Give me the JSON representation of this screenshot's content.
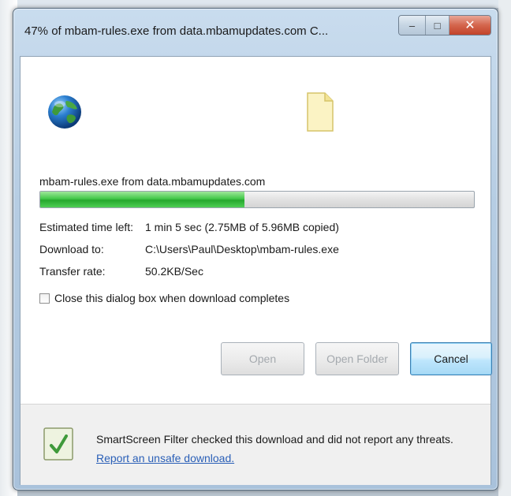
{
  "window": {
    "title": "47% of mbam-rules.exe from data.mbamupdates.com C...",
    "minimize_glyph": "–",
    "maximize_glyph": "□",
    "close_glyph": "✕"
  },
  "download": {
    "file_line": "mbam-rules.exe from data.mbamupdates.com",
    "progress_percent": 47,
    "estimated_label": "Estimated time left:",
    "estimated_value": "1 min 5 sec (2.75MB of 5.96MB copied)",
    "download_to_label": "Download to:",
    "download_to_value": "C:\\Users\\Paul\\Desktop\\mbam-rules.exe",
    "transfer_label": "Transfer rate:",
    "transfer_value": "50.2KB/Sec"
  },
  "options": {
    "close_when_done_label": "Close this dialog box when download completes",
    "close_when_done_checked": false
  },
  "buttons": {
    "open": "Open",
    "open_folder": "Open Folder",
    "cancel": "Cancel"
  },
  "footer": {
    "message": "SmartScreen Filter checked this download and did not report any threats.",
    "report_link": "Report an unsafe download."
  },
  "icons": {
    "globe": "globe-icon",
    "file": "file-icon",
    "shield": "smartscreen-shield-icon"
  },
  "colors": {
    "progress_green": "#2fb836",
    "link_blue": "#2a5fb7",
    "close_red": "#c9472d"
  }
}
